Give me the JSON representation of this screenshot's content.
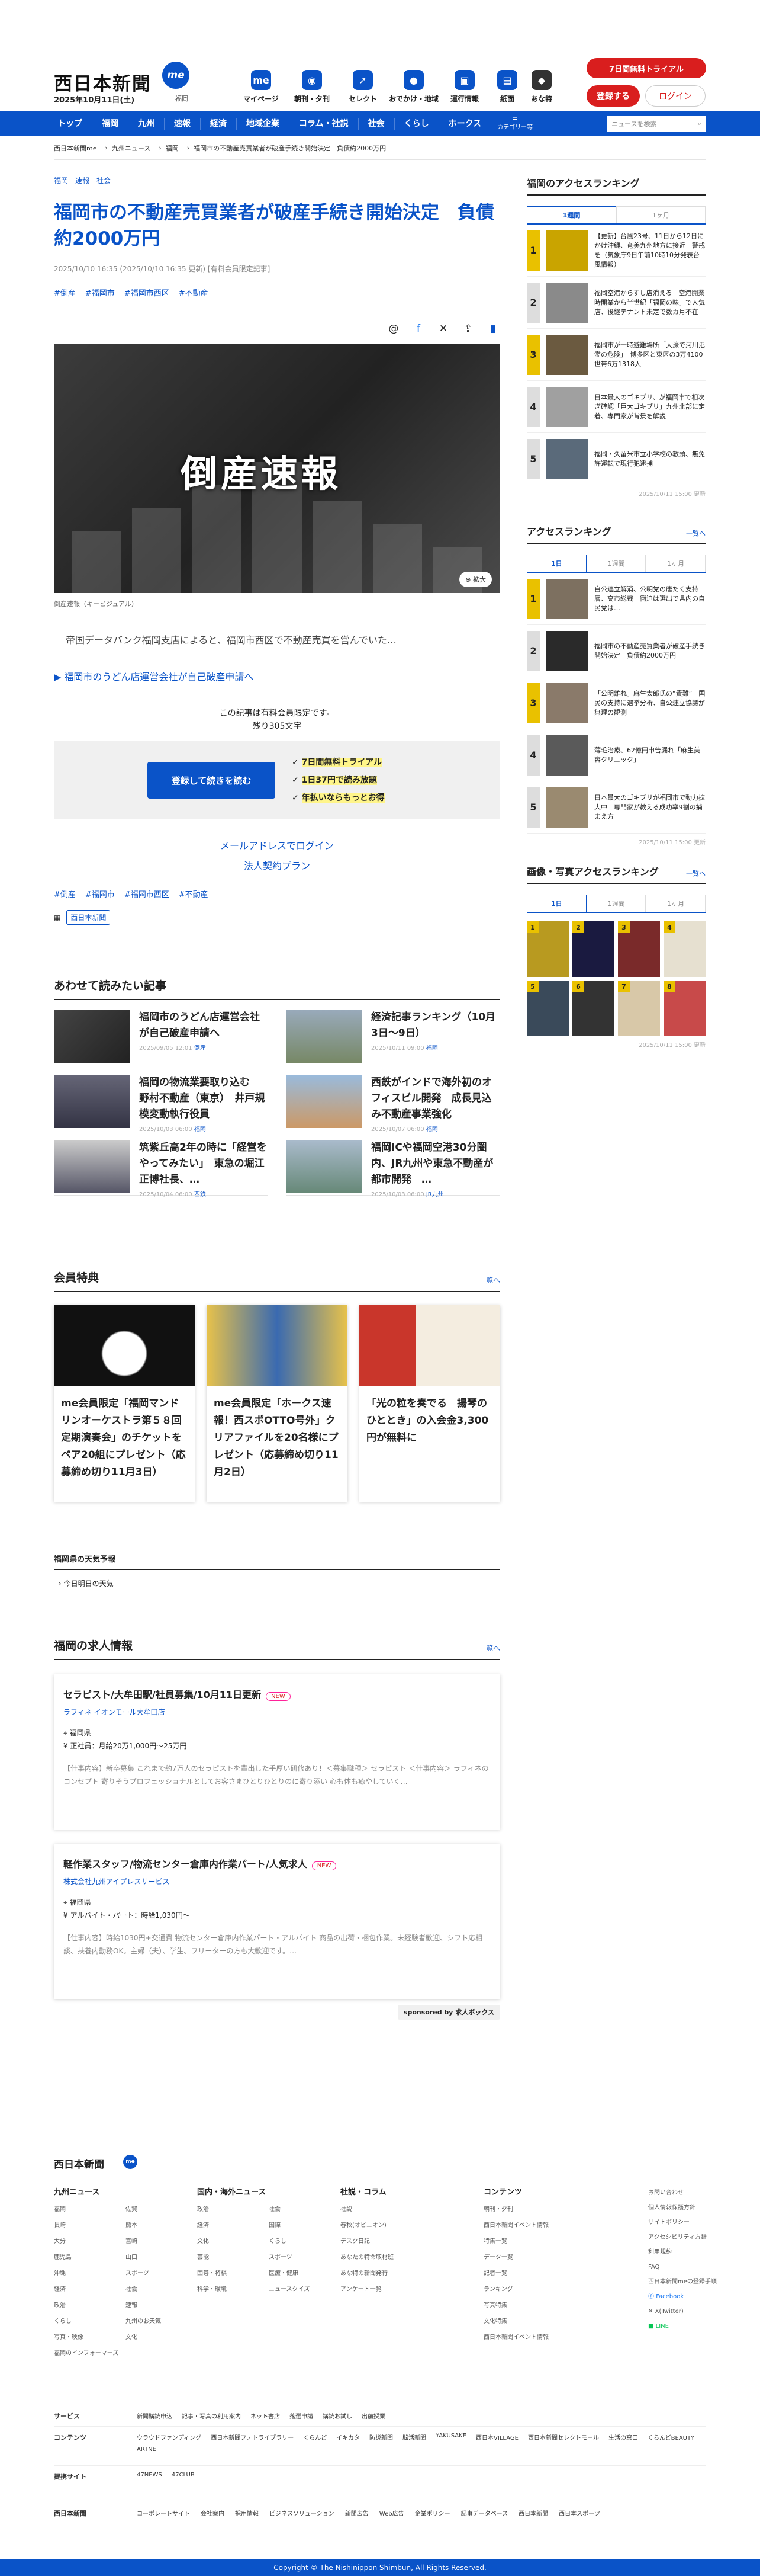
{
  "header": {
    "logo": "西日本新聞",
    "logo_badge": "me",
    "date": "2025年10月11日(土)",
    "region": "福岡",
    "trial": "7日間無料トライアル",
    "register": "登録する",
    "login": "ログイン",
    "icons": [
      {
        "label": "マイページ",
        "icon": "me-icon"
      },
      {
        "label": "朝刊・夕刊",
        "icon": "newspaper-icon"
      },
      {
        "label": "セレクト",
        "icon": "cursor-icon"
      },
      {
        "label": "おでかけ・地域",
        "icon": "footprint-icon"
      },
      {
        "label": "運行情報",
        "icon": "train-icon"
      },
      {
        "label": "紙面",
        "icon": "page-icon"
      },
      {
        "label": "あな特",
        "icon": "cat-icon"
      }
    ]
  },
  "nav": {
    "items": [
      "トップ",
      "福岡",
      "九州",
      "速報",
      "経済",
      "地域企業",
      "コラム・社説",
      "社会",
      "くらし",
      "ホークス"
    ],
    "category": "カテゴリー等",
    "search_placeholder": "ニュースを検索"
  },
  "breadcrumb": [
    "西日本新聞me",
    "九州ニュース",
    "福岡",
    "福岡市の不動産売買業者が破産手続き開始決定　負債約2000万円"
  ],
  "article": {
    "cats": [
      "福岡",
      "速報",
      "社会"
    ],
    "title": "福岡市の不動産売買業者が破産手続き開始決定　負債約2000万円",
    "meta": "2025/10/10 16:35 (2025/10/10 16:35 更新) [有料会員限定記事]",
    "tags": [
      "#倒産",
      "#福岡市",
      "#福岡市西区",
      "#不動産"
    ],
    "photo_text": "倒産速報",
    "enlarge": "拡大",
    "caption": "倒産速報（キービジュアル）",
    "lead": "帝国データバンク福岡支店によると、福岡市西区で不動産売買を営んでいた…",
    "related": "福岡市のうどん店運営会社が自己破産申請へ",
    "member_note": "この記事は有料会員限定です。",
    "remaining": "残り305文字",
    "pay_button": "登録して続きを読む",
    "perks": [
      "7日間無料トライアル",
      "1日37円で読み放題",
      "年払いならもっとお得"
    ],
    "mail_login": "メールアドレスでログイン",
    "corp": "法人契約プラン",
    "publisher": "西日本新聞"
  },
  "read_also": {
    "title": "あわせて読みたい記事",
    "items": [
      {
        "title": "福岡市のうどん店運営会社が自己破産申請へ",
        "date": "2025/09/05 12:01",
        "tag": "倒産"
      },
      {
        "title": "経済記事ランキング（10月3日～9日）",
        "date": "2025/10/11 09:00",
        "tag": "福岡"
      },
      {
        "title": "福岡の物流業要取り込む　野村不動産（東京）　井戸規模変動執行役員",
        "date": "2025/10/03 06:00",
        "tag": "福岡"
      },
      {
        "title": "西鉄がインドで海外初のオフィスビル開発　成長見込み不動産事業強化",
        "date": "2025/10/07 06:00",
        "tag": "福岡"
      },
      {
        "title": "筑紫丘高2年の時に「経営をやってみたい」　東急の堀江正博社長、…",
        "date": "2025/10/04 06:00",
        "tag": "西鉄"
      },
      {
        "title": "福岡ICや福岡空港30分圏内、JR九州や東急不動産が都市開発　…",
        "date": "2025/10/03 06:00",
        "tag": "JR九州"
      }
    ]
  },
  "member_benefits": {
    "title": "会員特典",
    "more": "一覧へ",
    "items": [
      "me会員限定「福岡マンドリンオーケストラ第５８回定期演奏会」のチケットをペア20組にプレゼント（応募締め切り11月3日）",
      "me会員限定「ホークス速報！西スポOTTO号外」クリアファイルを20名様にプレゼント（応募締め切り11月2日）",
      "「光の粒を奏でる　揚琴のひととき」の入会金3,300円が無料に"
    ]
  },
  "weather": {
    "title": "福岡県の天気予報",
    "sub": "今日明日の天気"
  },
  "jobs": {
    "title": "福岡の求人情報",
    "more": "一覧へ",
    "items": [
      {
        "title": "セラピスト/大牟田駅/社員募集/10月11日更新",
        "new": "NEW",
        "company": "ラフィネ イオンモール大牟田店",
        "loc": "福岡県",
        "pay": "正社員：月給20万1,000円〜25万円",
        "desc": "【仕事内容】新卒募集 これまで約7万人のセラピストを輩出した手厚い研修あり！＜募集職種＞ セラピスト ＜仕事内容＞ ラフィネのコンセプト 寄りそうプロフェッショナルとしてお客さまひとりひとりのに寄り添い 心も体も癒やしていく…"
      },
      {
        "title": "軽作業スタッフ/物流センター倉庫内作業パート/人気求人",
        "new": "NEW",
        "company": "株式会社九州アイプレスサービス",
        "loc": "福岡県",
        "pay": "アルバイト・パート：時給1,030円〜",
        "desc": "【仕事内容】時給1030円+交通費 物流センター倉庫内作業パート・アルバイト 商品の出荷・梱包作業。未経験者歓迎、シフト応相談、扶養内勤務OK。主婦（夫）、学生、フリーターの方も大歓迎です。…"
      }
    ],
    "sponsor": "sponsored by",
    "sponsor_name": "求人ボックス"
  },
  "sidebar": {
    "access_title": "福岡のアクセスランキング",
    "tabs1": [
      "1週間",
      "1ヶ月"
    ],
    "ranking1": [
      "【更新】台風23号、11日から12日にかけ沖縄、奄美九州地方に接近　警戒を（気象庁9日午前10時10分発表台風情報）",
      "福岡空港からすし店消える　空港開業時開業から半世紀「福岡の味」で人気店、後継テナント未定で数カ月不在",
      "福岡市が一時避難場所「大濠で河川氾濫の危険」　博多区と東区の3万4100世帯6万1318人",
      "日本最大のゴキブリ、が福岡市で相次ぎ確認「巨大ゴキブリ」九州北部に定着、専門家が背景を解説",
      "福岡・久留米市立小学校の教頭、無免許運転で現行犯逮捕"
    ],
    "upd1": "2025/10/11 15:00 更新",
    "access2_title": "アクセスランキング",
    "more": "一覧へ",
    "tabs2": [
      "1日",
      "1週間",
      "1ヶ月"
    ],
    "ranking2": [
      "自公連立解消、公明党の唐たく支持層、高市総裁　衝迫は選出で県内の自民党は…",
      "福岡市の不動産売買業者が破産手続き開始決定　負債約2000万円",
      "「公明離れ」麻生太郎氏の“責難”　国民の支持に選挙分析、自公連立協議が無理の観測",
      "薄毛治療、62億円申告漏れ「麻生美容クリニック」",
      "日本最大のゴキブリが福岡市で動力拡大中　専門家が教える成功率9割の捕まえ方"
    ],
    "upd2": "2025/10/11 15:00 更新",
    "photo_title": "画像・写真アクセスランキング",
    "tabs3": [
      "1日",
      "1週間",
      "1ヶ月"
    ],
    "photo_nums": [
      "1",
      "2",
      "3",
      "4",
      "5",
      "6",
      "7",
      "8"
    ],
    "upd3": "2025/10/11 15:00 更新"
  },
  "footer": {
    "logo": "西日本新聞",
    "cols": [
      {
        "title": "九州ニュース",
        "items": [
          "福岡",
          "佐賀",
          "長崎",
          "熊本",
          "大分",
          "宮崎",
          "鹿児島",
          "山口",
          "沖縄",
          "スポーツ",
          "経済",
          "社会",
          "政治",
          "速報",
          "くらし",
          "九州のお天気",
          "写真・映像",
          "文化",
          "福岡のインフォーマーズ"
        ]
      },
      {
        "title": "国内・海外ニュース",
        "items": [
          "政治",
          "社会",
          "経済",
          "国際",
          "文化",
          "くらし",
          "芸能",
          "スポーツ",
          "囲碁・将棋",
          "医療・健康",
          "科学・環境",
          "ニュースクイズ"
        ]
      },
      {
        "title": "社説・コラム",
        "items": [
          "社説",
          "春秋(オピニオン)",
          "デスク日記",
          "あなたの特命取材班",
          "あな特の新聞発行",
          "アンケート一覧"
        ]
      },
      {
        "title": "コンテンツ",
        "items": [
          "朝刊・夕刊",
          "西日本新聞イベント情報",
          "特集一覧",
          "データ一覧",
          "記者一覧",
          "ランキング",
          "写真特集",
          "文化特集",
          "西日本新聞イベント情報"
        ]
      }
    ],
    "right": [
      "お問い合わせ",
      "個人情報保護方針",
      "サイトポリシー",
      "アクセシビリティ方針",
      "利用規約",
      "FAQ",
      "西日本新聞meの登録手順",
      "Facebook",
      "X(Twitter)",
      "LINE"
    ],
    "service_label": "サービス",
    "service": [
      "新聞購読申込",
      "記事・写真の利用案内",
      "ネット書店",
      "落選申請",
      "講読お試し",
      "出前授業"
    ],
    "content_label": "コンテンツ",
    "content": [
      "ウラウドファンディング",
      "西日本新聞フォトライブラリー",
      "くらんど",
      "イキカタ",
      "防災新聞",
      "脳活新聞",
      "YAKUSAKE",
      "西日本VILLAGE",
      "西日本新聞セレクトモール",
      "生活の窓口",
      "くらんどBEAUTY",
      "ARTNE"
    ],
    "link_label": "提携サイト",
    "links": [
      "47NEWS",
      "47CLUB"
    ],
    "bottom": [
      "コーポレートサイト",
      "会社案内",
      "採用情報",
      "ビジネスソリューション",
      "新聞広告",
      "Web広告",
      "企業ポリシー",
      "記事データベース",
      "西日本新聞",
      "西日本スポーツ"
    ],
    "copyright": "Copyright © The Nishinippon Shimbun, All Rights Reserved."
  }
}
